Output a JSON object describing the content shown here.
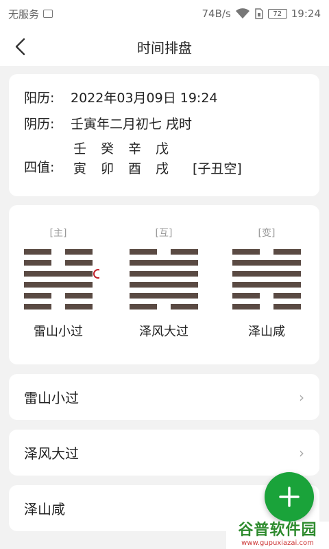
{
  "status_bar": {
    "carrier": "无服务",
    "net_speed": "74B/s",
    "battery": "72",
    "time": "19:24"
  },
  "header": {
    "title": "时间排盘"
  },
  "info": {
    "solar_label": "阳历:",
    "solar_value": "2022年03月09日 19:24",
    "lunar_label": "阴历:",
    "lunar_value": "壬寅年二月初七 戌时",
    "pillars_label": "四值:",
    "pillars_top": [
      "壬",
      "癸",
      "辛",
      "戊"
    ],
    "pillars_bottom": [
      "寅",
      "卯",
      "酉",
      "戌"
    ],
    "void": "[子丑空]"
  },
  "hexagrams": [
    {
      "tag": "[主]",
      "name": "雷山小过",
      "lines": [
        0,
        0,
        1,
        1,
        0,
        0
      ],
      "moving_line": 2
    },
    {
      "tag": "[互]",
      "name": "泽风大过",
      "lines": [
        0,
        1,
        1,
        1,
        1,
        0
      ],
      "moving_line": null
    },
    {
      "tag": "[变]",
      "name": "泽山咸",
      "lines": [
        0,
        1,
        1,
        1,
        0,
        0
      ],
      "moving_line": null
    }
  ],
  "list": [
    {
      "label": "雷山小过"
    },
    {
      "label": "泽风大过"
    },
    {
      "label": "泽山咸"
    }
  ],
  "watermark": {
    "main": "谷普软件园",
    "sub": "www.gupuxiazai.com"
  },
  "colors": {
    "line": "#5a4a43",
    "moving": "#c0202a",
    "fab": "#1aa33a"
  }
}
